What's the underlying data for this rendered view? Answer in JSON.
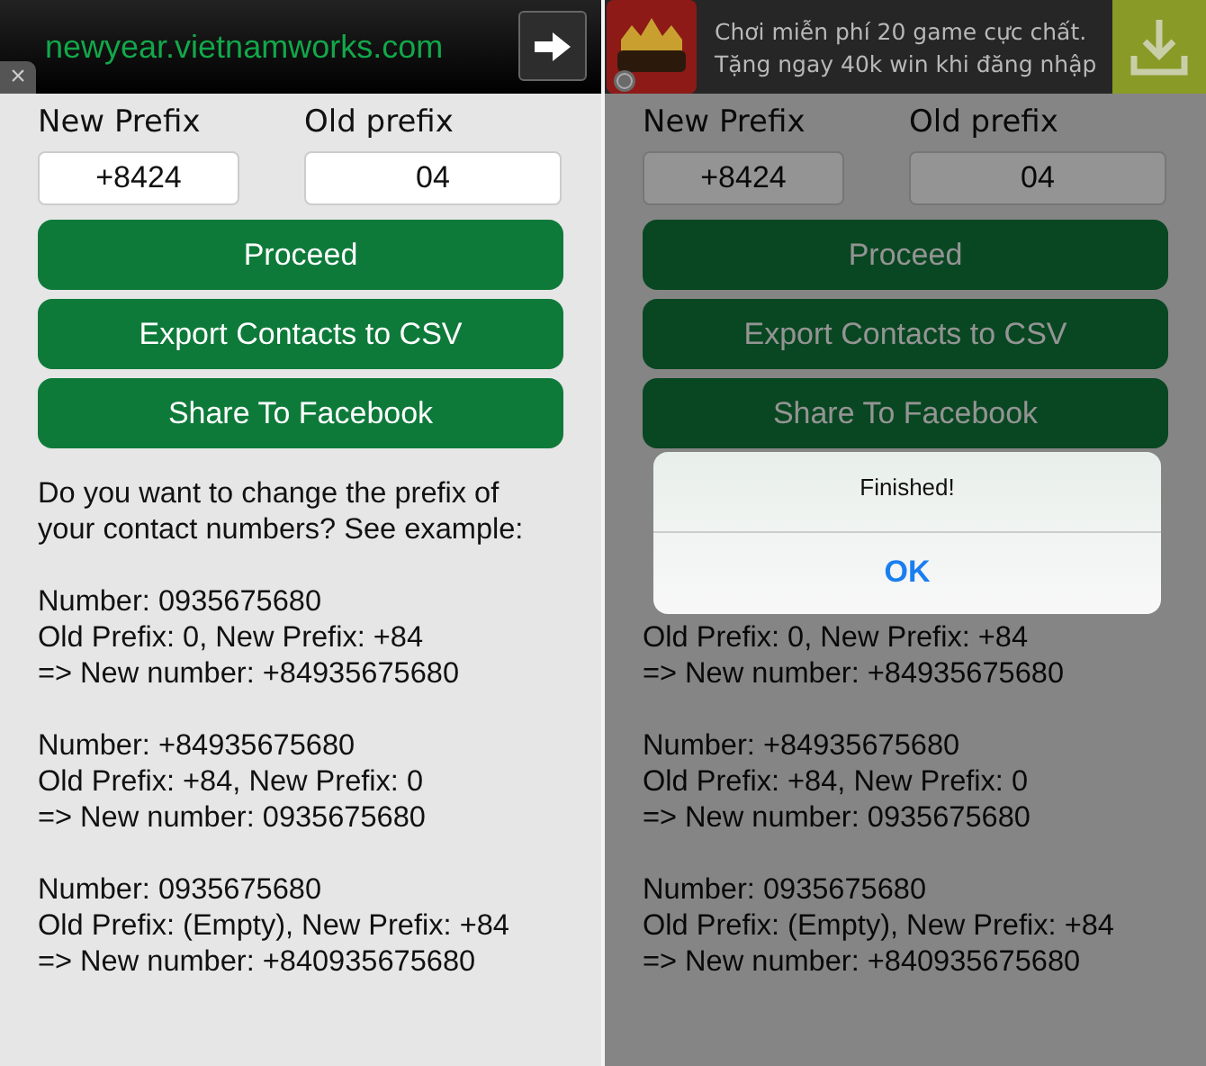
{
  "screens": [
    {
      "banner": {
        "kind": "link",
        "text": "newyear.vietnamworks.com",
        "close": "×"
      },
      "labels": [
        "New Prefix",
        "Old prefix"
      ],
      "fields": [
        "+8424",
        "04"
      ],
      "buttons": [
        "Proceed",
        "Export Contacts to CSV",
        "Share To Facebook"
      ],
      "paragraphs": [
        [
          "Do you want to change the prefix of",
          "your contact numbers? See example:"
        ],
        [
          "Number: 0935675680",
          "Old Prefix: 0, New Prefix: +84",
          "=> New number: +84935675680"
        ],
        [
          "Number: +84935675680",
          "Old Prefix: +84, New Prefix: 0",
          "=> New number: 0935675680"
        ],
        [
          "Number: 0935675680",
          "Old Prefix: (Empty), New Prefix: +84",
          "=> New number: +840935675680"
        ]
      ],
      "dimmed": false
    },
    {
      "banner": {
        "kind": "ad",
        "lines": [
          "Chơi miễn phí 20 game cực chất.",
          "Tặng ngay 40k win khi đăng nhập"
        ]
      },
      "labels": [
        "New Prefix",
        "Old prefix"
      ],
      "fields": [
        "+8424",
        "04"
      ],
      "buttons": [
        "Proceed",
        "Export Contacts to CSV",
        "Share To Facebook"
      ],
      "paragraphs": [
        [
          "Old Prefix: 0, New Prefix: +84",
          "=> New number: +84935675680"
        ],
        [
          "Number: +84935675680",
          "Old Prefix: +84, New Prefix: 0",
          "=> New number: 0935675680"
        ],
        [
          "Number: 0935675680",
          "Old Prefix: (Empty), New Prefix: +84",
          "=> New number: +840935675680"
        ]
      ],
      "dimmed": true,
      "alert": {
        "title": "Finished!",
        "button": "OK"
      }
    }
  ]
}
